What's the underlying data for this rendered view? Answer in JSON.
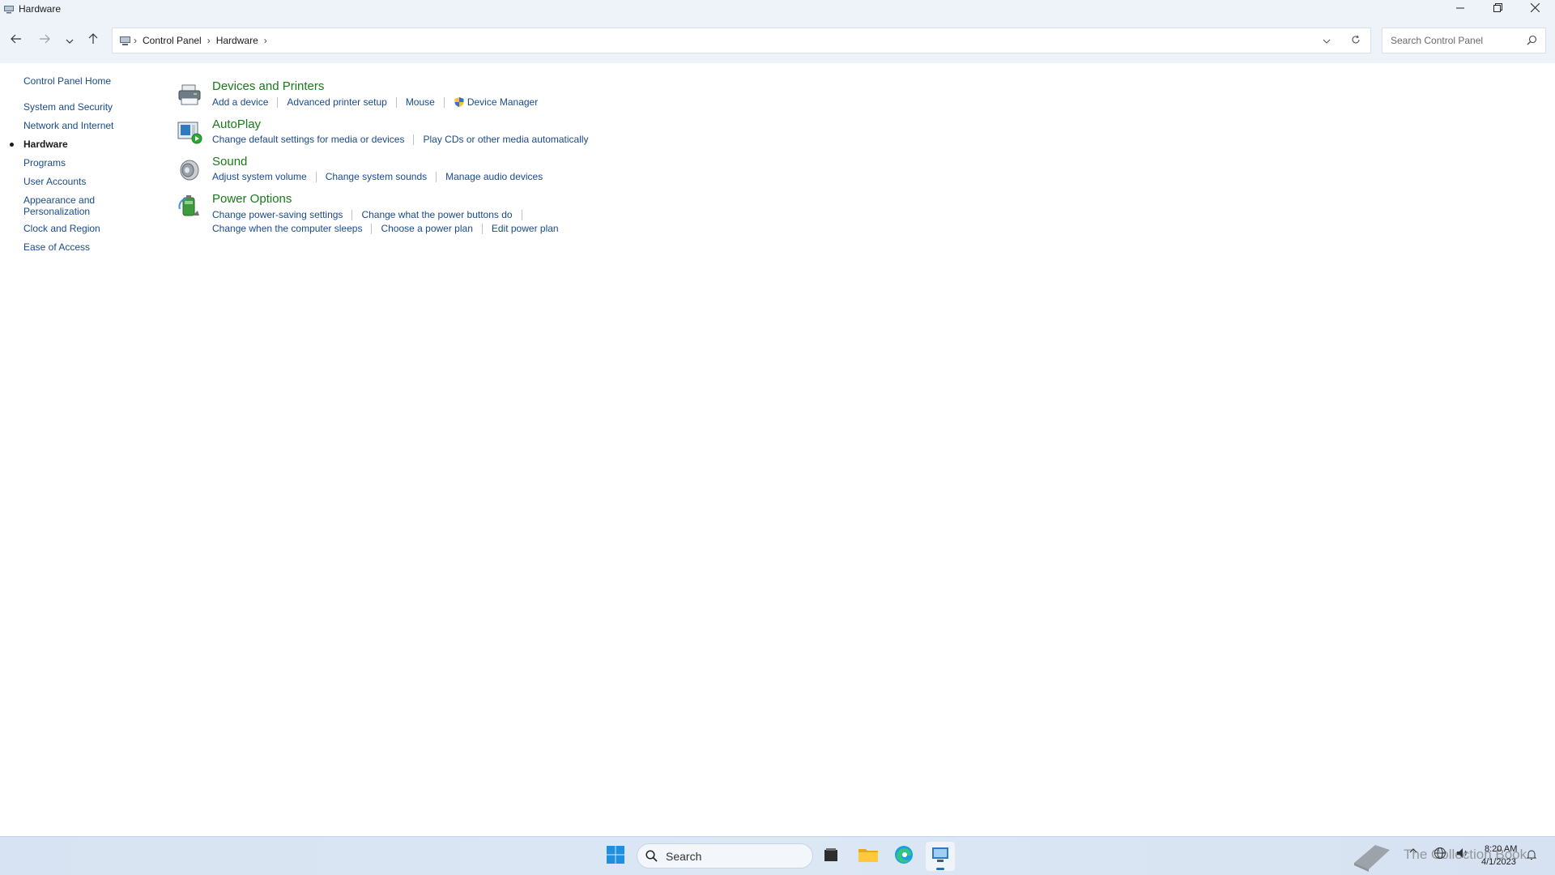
{
  "window": {
    "title": "Hardware",
    "minimize_icon": "minimize-icon",
    "maximize_icon": "restore-icon",
    "close_icon": "close-icon"
  },
  "address_bar": {
    "breadcrumbs": [
      "Control Panel",
      "Hardware"
    ],
    "search_placeholder": "Search Control Panel"
  },
  "left_nav": {
    "home": "Control Panel Home",
    "items": [
      {
        "label": "System and Security"
      },
      {
        "label": "Network and Internet"
      },
      {
        "label": "Hardware",
        "current": true
      },
      {
        "label": "Programs"
      },
      {
        "label": "User Accounts"
      },
      {
        "label": "Appearance and Personalization"
      },
      {
        "label": "Clock and Region"
      },
      {
        "label": "Ease of Access"
      }
    ]
  },
  "categories": [
    {
      "title": "Devices and Printers",
      "icon": "printer-icon",
      "tasks": [
        [
          "Add a device",
          "Advanced printer setup",
          "Mouse",
          "Device Manager"
        ]
      ]
    },
    {
      "title": "AutoPlay",
      "icon": "autoplay-icon",
      "tasks": [
        [
          "Change default settings for media or devices",
          "Play CDs or other media automatically"
        ]
      ]
    },
    {
      "title": "Sound",
      "icon": "speaker-icon",
      "tasks": [
        [
          "Adjust system volume",
          "Change system sounds",
          "Manage audio devices"
        ]
      ]
    },
    {
      "title": "Power Options",
      "icon": "battery-icon",
      "tasks": [
        [
          "Change power-saving settings",
          "Change what the power buttons do"
        ],
        [
          "Change when the computer sleeps",
          "Choose a power plan",
          "Edit power plan"
        ]
      ]
    }
  ],
  "taskbar": {
    "search_label": "Search",
    "time": "8:20 AM",
    "date": "4/1/2023",
    "watermark": "The Collection Book"
  },
  "colors": {
    "category_green": "#197a19",
    "link_blue": "#1a4a8a"
  }
}
